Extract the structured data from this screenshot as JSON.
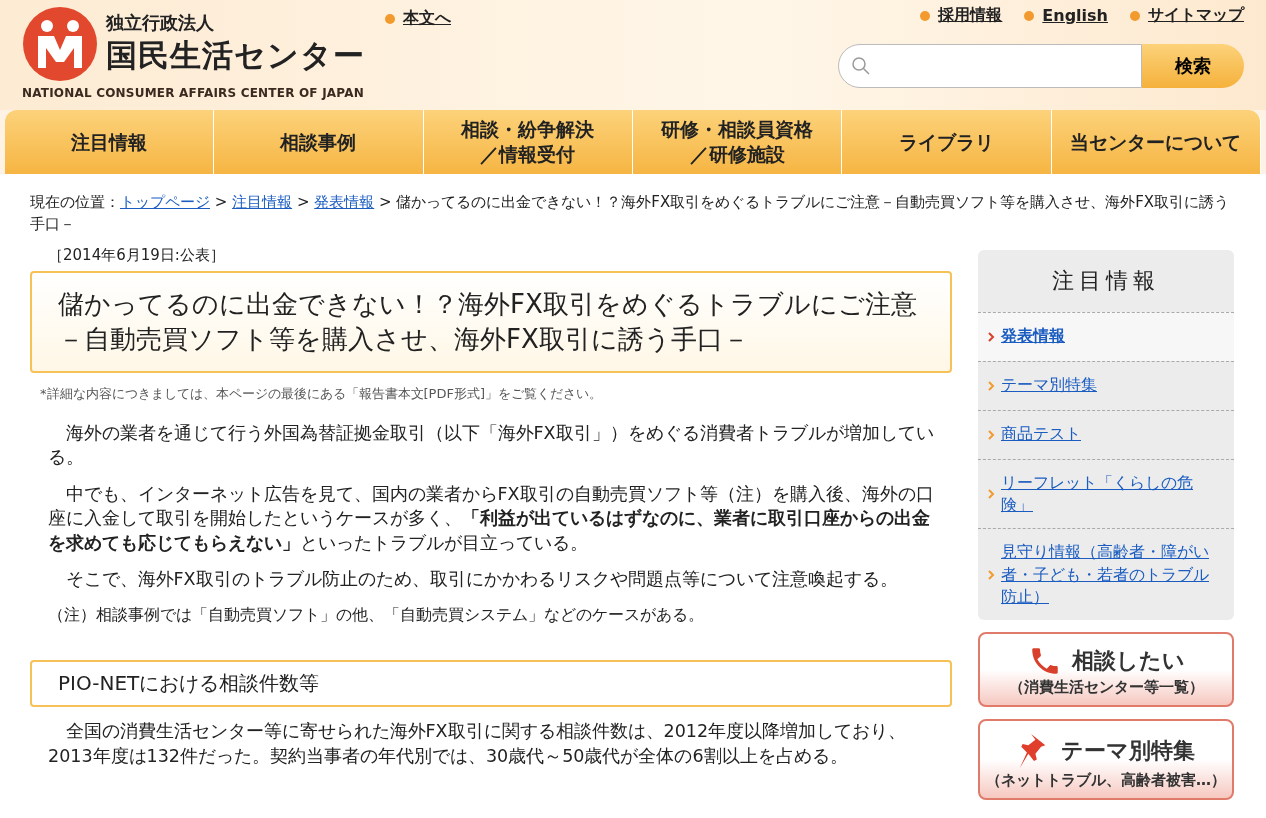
{
  "header": {
    "org_type": "独立行政法人",
    "org_name": "国民生活センター",
    "org_name_en": "NATIONAL CONSUMER AFFAIRS CENTER OF JAPAN",
    "skip_link": "本文へ",
    "top_links": [
      "採用情報",
      "English",
      "サイトマップ"
    ],
    "search": {
      "button": "検索"
    }
  },
  "nav": [
    {
      "lines": [
        "注目情報"
      ]
    },
    {
      "lines": [
        "相談事例"
      ]
    },
    {
      "lines": [
        "相談・紛争解決",
        "／情報受付"
      ]
    },
    {
      "lines": [
        "研修・相談員資格",
        "／研修施設"
      ]
    },
    {
      "lines": [
        "ライブラリ"
      ]
    },
    {
      "lines": [
        "当センターについて"
      ]
    }
  ],
  "breadcrumb": {
    "label": "現在の位置：",
    "separator": ">",
    "links": [
      "トップページ",
      "注目情報",
      "発表情報"
    ],
    "current": "儲かってるのに出金できない！？海外FX取引をめぐるトラブルにご注意－自動売買ソフト等を購入させ、海外FX取引に誘う手口－"
  },
  "article": {
    "date": "［2014年6月19日:公表］",
    "title": "儲かってるのに出金できない！？海外FX取引をめぐるトラブルにご注意－自動売買ソフト等を購入させ、海外FX取引に誘う手口－",
    "note": "*詳細な内容につきましては、本ページの最後にある「報告書本文[PDF形式]」をご覧ください。",
    "paragraphs": [
      {
        "kind": "body",
        "text": "海外の業者を通じて行う外国為替証拠金取引（以下「海外FX取引」）をめぐる消費者トラブルが増加している。"
      },
      {
        "kind": "body",
        "text": "中でも、インターネット広告を見て、国内の業者からFX取引の自動売買ソフト等（注）を購入後、海外の口座に入金して取引を開始したというケースが多く、**「利益が出ているはずなのに、業者に取引口座からの出金を求めても応じてもらえない」**といったトラブルが目立っている。"
      },
      {
        "kind": "body",
        "text": "そこで、海外FX取引のトラブル防止のため、取引にかかわるリスクや問題点等について注意喚起する。"
      },
      {
        "kind": "note",
        "text": "（注）相談事例では「自動売買ソフト」の他、「自動売買システム」などのケースがある。"
      }
    ],
    "section": {
      "heading": "PIO-NETにおける相談件数等",
      "paragraphs": [
        "全国の消費生活センター等に寄せられた海外FX取引に関する相談件数は、2012年度以降増加しており、2013年度は132件だった。契約当事者の年代別では、30歳代～50歳代が全体の6割以上を占める。"
      ]
    }
  },
  "sidebar": {
    "title": "注目情報",
    "items": [
      {
        "label": "発表情報",
        "selected": true
      },
      {
        "label": "テーマ別特集",
        "selected": false
      },
      {
        "label": "商品テスト",
        "selected": false
      },
      {
        "label": "リーフレット「くらしの危険」",
        "selected": false
      },
      {
        "label": "見守り情報（高齢者・障がい者・子ども・若者のトラブル防止）",
        "selected": false
      }
    ],
    "banners": [
      {
        "kind": "phone",
        "title": "相談したい",
        "subtitle": "（消費生活センター等一覧）"
      },
      {
        "kind": "pin",
        "title": "テーマ別特集",
        "subtitle": "（ネットトラブル、高齢者被害…）"
      }
    ]
  }
}
